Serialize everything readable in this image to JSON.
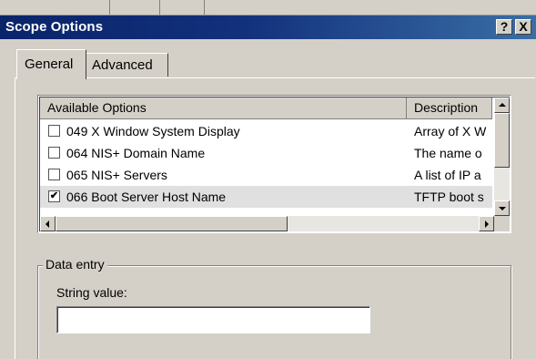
{
  "window": {
    "title": "Scope Options",
    "help_label": "?",
    "close_label": "X"
  },
  "tabs": [
    {
      "label": "General",
      "active": true
    },
    {
      "label": "Advanced",
      "active": false
    }
  ],
  "options_list": {
    "columns": [
      "Available Options",
      "Description"
    ],
    "rows": [
      {
        "checked": false,
        "name": "049 X Window System Display",
        "description": "Array of X W",
        "selected": false
      },
      {
        "checked": false,
        "name": "064 NIS+ Domain Name",
        "description": "The name o",
        "selected": false
      },
      {
        "checked": false,
        "name": "065 NIS+ Servers",
        "description": "A list of IP a",
        "selected": false
      },
      {
        "checked": true,
        "name": "066 Boot Server Host Name",
        "description": "TFTP boot s",
        "selected": true
      }
    ]
  },
  "data_entry": {
    "group_title": "Data entry",
    "string_label": "String value:",
    "string_value": ""
  },
  "icons": {
    "checkmark": "✔"
  }
}
